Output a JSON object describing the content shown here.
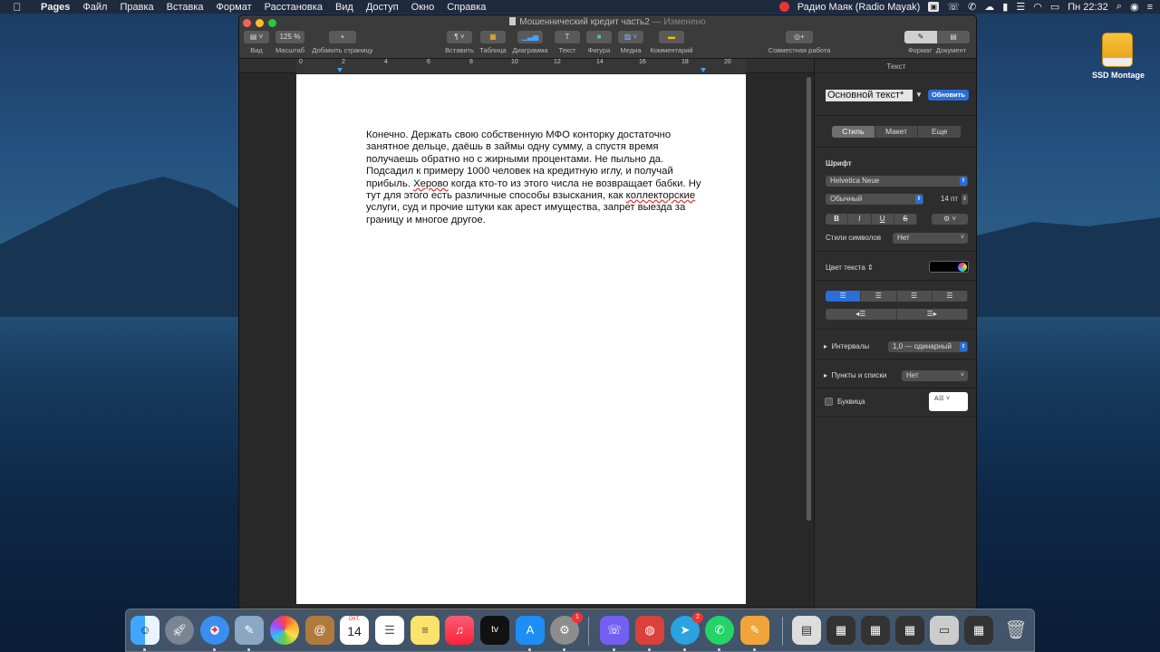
{
  "menubar": {
    "app_name": "Pages",
    "items": [
      "Файл",
      "Правка",
      "Вставка",
      "Формат",
      "Расстановка",
      "Вид",
      "Доступ",
      "Окно",
      "Справка"
    ],
    "radio": "Радио Маяк (Radio Mayak)",
    "clock": "Пн 22:32"
  },
  "desktop": {
    "drive_label": "SSD Montage"
  },
  "window": {
    "title": "Мошеннический кредит часть2",
    "edited": "— Изменено",
    "toolbar": {
      "view_label": "Вид",
      "zoom_value": "125 %",
      "zoom_label": "Масштаб",
      "add_page_label": "Добавить страницу",
      "insert_label": "Вставить",
      "table_label": "Таблица",
      "chart_label": "Диаграмма",
      "text_label": "Текст",
      "shape_label": "Фигура",
      "media_label": "Медиа",
      "comment_label": "Комментарий",
      "collab_label": "Совместная работа",
      "format_label": "Формат",
      "document_label": "Документ"
    },
    "ruler_numbers": [
      "0",
      "2",
      "4",
      "6",
      "8",
      "10",
      "12",
      "14",
      "16",
      "18",
      "20"
    ],
    "document_text_before": "Конечно. Держать свою собственную МФО конторку достаточно занятное дельце, даёшь в займы одну сумму, а спустя время получаешь обратно но с жирными процентами. Не пыльно да. Подсадил к примеру 1000 человек на кредитную иглу, и получай прибыль. ",
    "document_misspelled_1": "Херово",
    "document_text_mid": " когда кто-то из этого числа не возвращает бабки. Ну тут для этого есть различные способы взыскания, как ",
    "document_misspelled_2": "коллекторские",
    "document_text_after": " услуги, суд и прочие штуки как арест имущества, запрет выезда за границу и многое другое."
  },
  "inspector": {
    "title": "Текст",
    "paragraph_style": "Основной текст*",
    "update_button": "Обновить",
    "tabs": [
      "Стиль",
      "Макет",
      "Еще"
    ],
    "font_heading": "Шрифт",
    "font_name": "Helvetica Neue",
    "font_weight": "Обычный",
    "font_size": "14 пт",
    "format_buttons": [
      "B",
      "I",
      "U",
      "S"
    ],
    "char_styles_label": "Стили символов",
    "char_styles_value": "Нет",
    "text_color_label": "Цвет текста",
    "spacing_label": "Интервалы",
    "spacing_value": "1,0 — одинарный",
    "bullets_label": "Пункты и списки",
    "bullets_value": "Нет",
    "dropcap_label": "Буквица"
  },
  "dock": {
    "badge_settings": "1",
    "badge_telegram": "2",
    "calendar_month": "ОКТ.",
    "calendar_day": "14",
    "tv_label": "tv"
  }
}
